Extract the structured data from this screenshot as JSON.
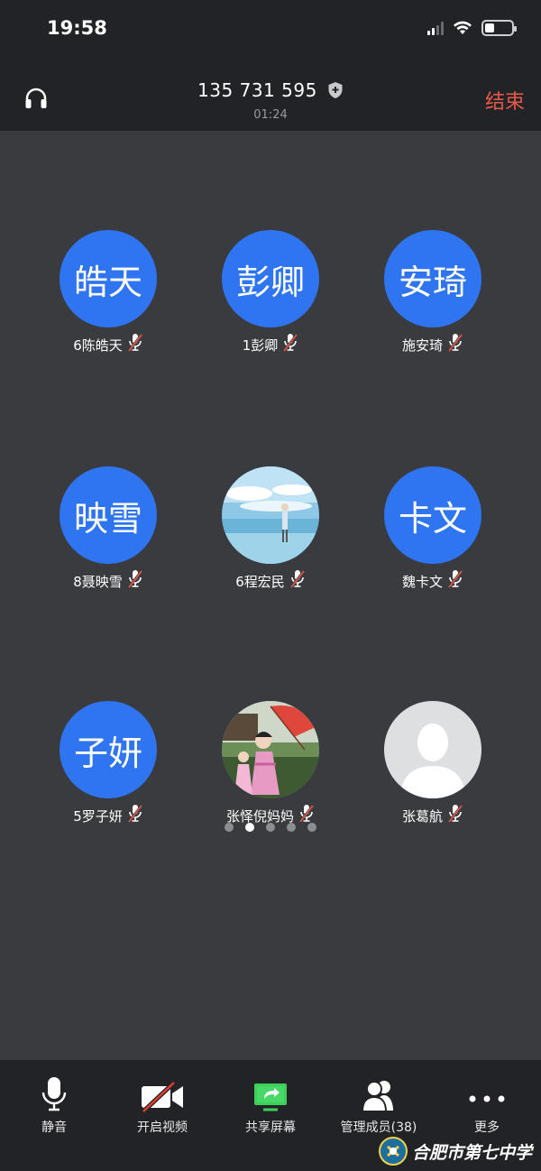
{
  "status_bar": {
    "time": "19:58",
    "battery_level": 0.35
  },
  "header": {
    "meeting_id": "135 731 595",
    "duration": "01:24",
    "end_label": "结束",
    "headset_icon": "headset-icon",
    "shield_icon": "shield-icon"
  },
  "participants": [
    {
      "avatar_text": "皓天",
      "name": "6陈皓天",
      "avatar_type": "text",
      "muted": true
    },
    {
      "avatar_text": "彭卿",
      "name": "1彭卿",
      "avatar_type": "text",
      "muted": true
    },
    {
      "avatar_text": "安琦",
      "name": "施安琦",
      "avatar_type": "text",
      "muted": true
    },
    {
      "avatar_text": "映雪",
      "name": "8聂映雪",
      "avatar_type": "text",
      "muted": true
    },
    {
      "avatar_text": "",
      "name": "6程宏民",
      "avatar_type": "photo-sky",
      "muted": true
    },
    {
      "avatar_text": "卡文",
      "name": "魏卡文",
      "avatar_type": "text",
      "muted": true
    },
    {
      "avatar_text": "子妍",
      "name": "5罗子妍",
      "avatar_type": "text",
      "muted": true
    },
    {
      "avatar_text": "",
      "name": "张怿倪妈妈",
      "avatar_type": "photo-girl",
      "muted": true
    },
    {
      "avatar_text": "",
      "name": "张葛航",
      "avatar_type": "default",
      "muted": true
    }
  ],
  "pagination": {
    "pages": 5,
    "current": 2
  },
  "toolbar": {
    "mute_label": "静音",
    "video_label": "开启视频",
    "share_label": "共享屏幕",
    "members_label": "管理成员(38)",
    "more_label": "更多"
  },
  "watermark": {
    "text": "合肥市第七中学"
  },
  "colors": {
    "avatar_blue": "#2f74f0",
    "end_red": "#e8584b",
    "share_green": "#3ecf5a",
    "video_off_red": "#e23b2f"
  }
}
